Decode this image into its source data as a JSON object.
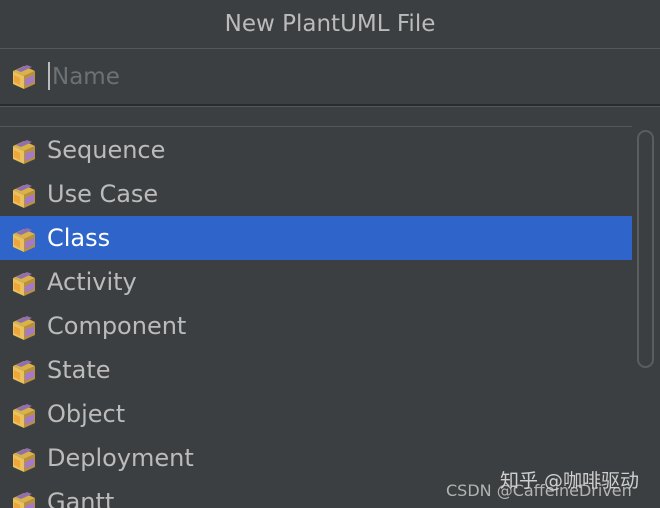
{
  "window": {
    "title": "New PlantUML File"
  },
  "name_field": {
    "value": "",
    "placeholder": "Name",
    "icon": "plantuml-file-icon"
  },
  "file_types": {
    "selected_index": 2,
    "icon": "plantuml-file-icon",
    "items": [
      {
        "label": "Sequence"
      },
      {
        "label": "Use Case"
      },
      {
        "label": "Class"
      },
      {
        "label": "Activity"
      },
      {
        "label": "Component"
      },
      {
        "label": "State"
      },
      {
        "label": "Object"
      },
      {
        "label": "Deployment"
      },
      {
        "label": "Gantt"
      }
    ]
  },
  "colors": {
    "background": "#3c3f41",
    "selection": "#2f65ca",
    "text": "#bbbbbb"
  },
  "watermark": {
    "line1": "知乎 @咖啡驱动",
    "line2": "CSDN @CaffeineDriven"
  }
}
